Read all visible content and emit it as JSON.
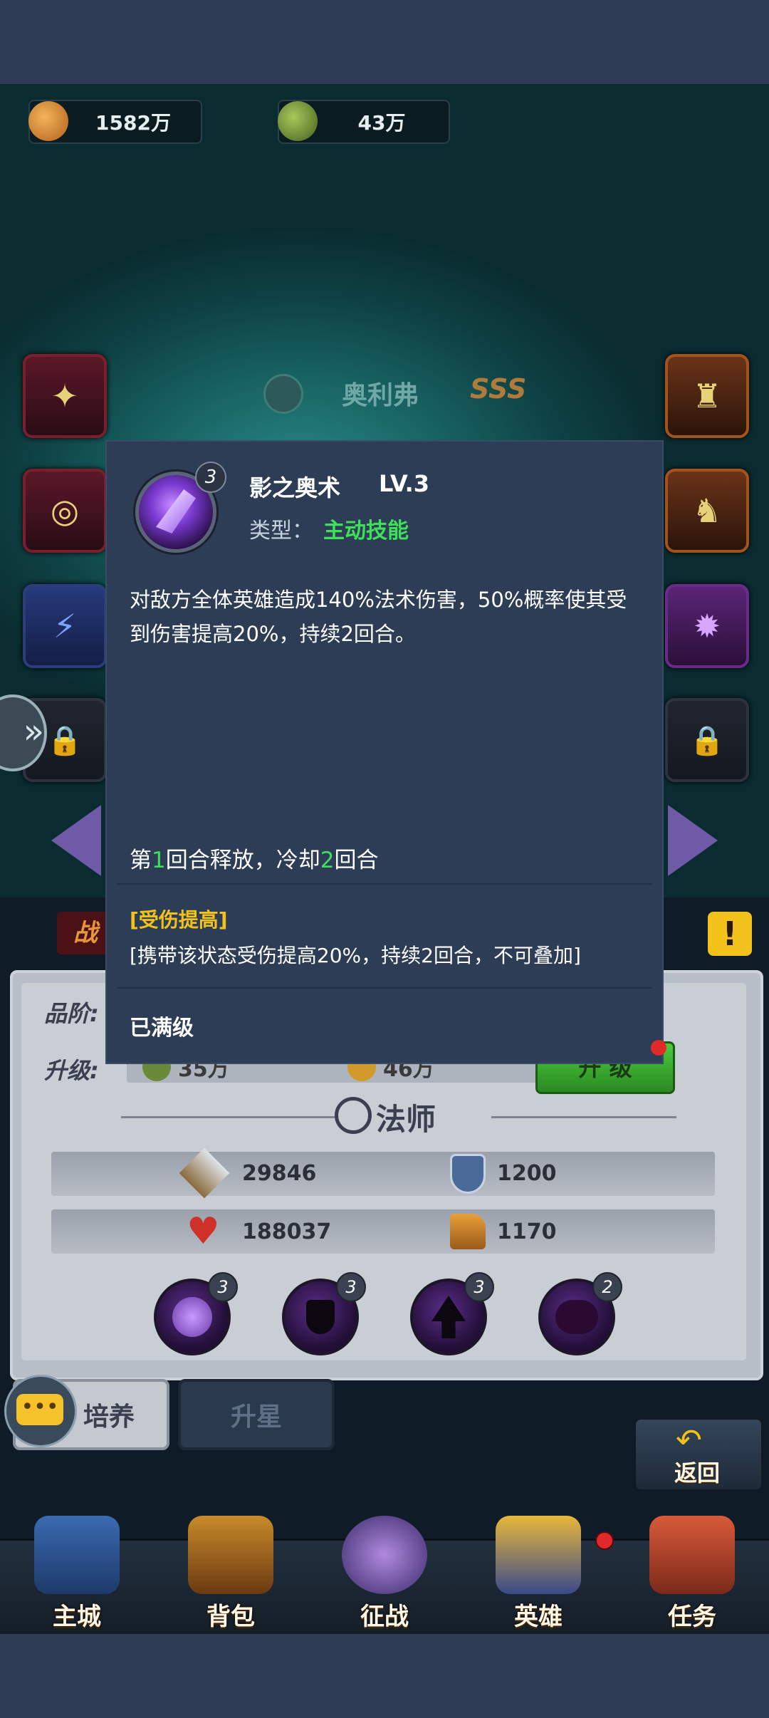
{
  "resources": [
    {
      "icon": "meat-icon",
      "value": "1582万"
    },
    {
      "icon": "herb-ore-icon",
      "value": "43万"
    }
  ],
  "hero": {
    "name": "奥利弗",
    "rank": "SSS"
  },
  "popup": {
    "skill_icon": "shadow-claw-icon",
    "skill_level_badge": "3",
    "skill_name": "影之奥术",
    "skill_level": "LV.3",
    "type_label": "类型：",
    "type_value": "主动技能",
    "description": "对敌方全体英雄造成140%法术伤害，50%概率使其受到伤害提高20%，持续2回合。",
    "cast_prefix": "第",
    "cast_round": "1",
    "cast_mid": "回合释放，冷却",
    "cooldown": "2",
    "cast_suffix": "回合",
    "status_title": "[受伤提高]",
    "status_desc": "[携带该状态受伤提高20%，持续2回合，不可叠加]",
    "max_level": "已满级"
  },
  "panel": {
    "quality_label": "品阶:",
    "upgrade_label": "升级:",
    "cost_herb": "35万",
    "cost_gold": "46万",
    "upgrade_button": "升 级",
    "class_name": "法师",
    "attack": "29846",
    "defense": "1200",
    "hp": "188037",
    "speed": "1170",
    "skills": [
      {
        "icon": "shadow-claw-icon",
        "level": "3"
      },
      {
        "icon": "dark-shield-icon",
        "level": "3"
      },
      {
        "icon": "dark-tree-icon",
        "level": "3"
      },
      {
        "icon": "dark-cloud-icon",
        "level": "2"
      }
    ],
    "tab_train": "培养",
    "tab_star": "升星",
    "battle_label": "战",
    "back_button": "返回"
  },
  "nav": [
    {
      "label": "主城",
      "icon": "castle-icon"
    },
    {
      "label": "背包",
      "icon": "chest-icon"
    },
    {
      "label": "征战",
      "icon": "dragon-portal-icon"
    },
    {
      "label": "英雄",
      "icon": "helmet-icon"
    },
    {
      "label": "任务",
      "icon": "scroll-icon"
    }
  ],
  "colors": {
    "accent_green": "#3ee05a",
    "status_yellow": "#f2c21a",
    "popup_bg": "#2d3d55"
  }
}
